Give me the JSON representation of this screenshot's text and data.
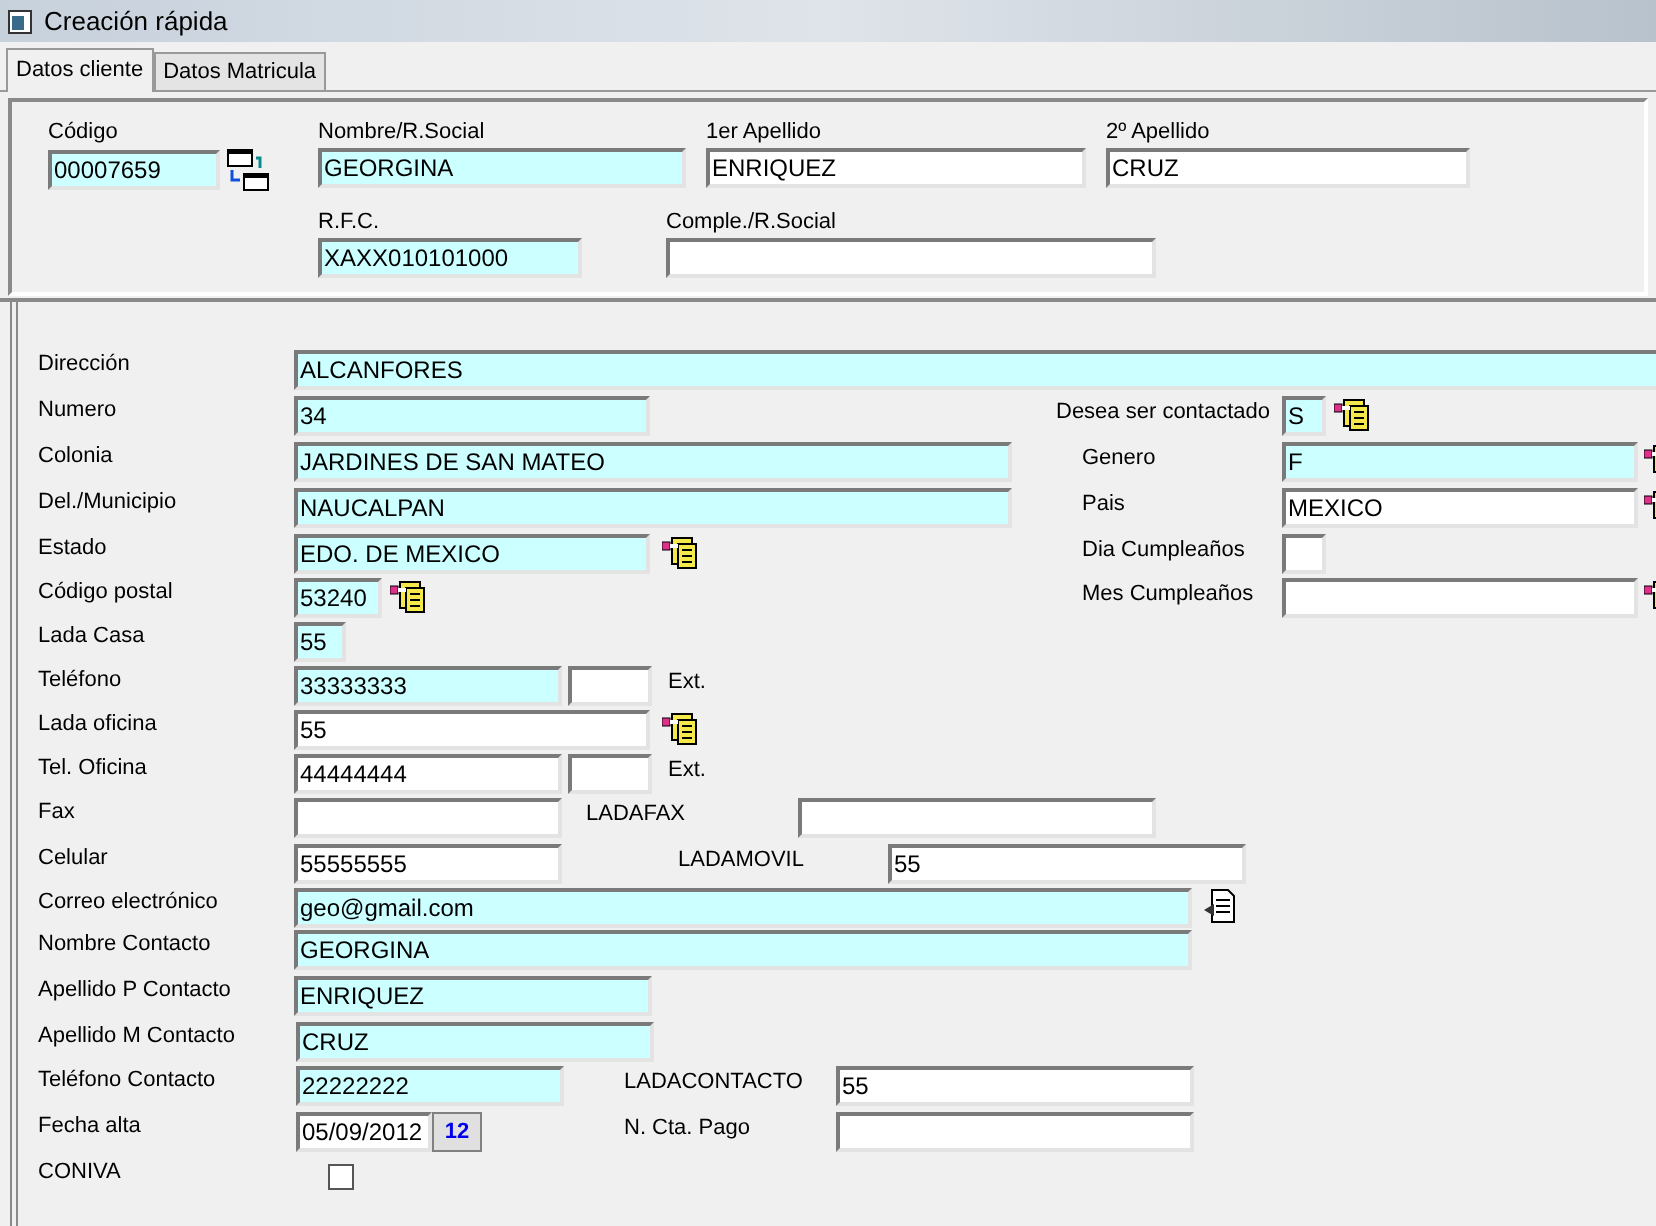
{
  "window": {
    "title": "Creación rápida"
  },
  "tabs": [
    {
      "label": "Datos cliente",
      "selected": true
    },
    {
      "label": "Datos Matricula",
      "selected": false
    }
  ],
  "top_fields": [
    [
      {
        "label": "Código",
        "value": "00007659",
        "highlighted": true
      },
      {
        "label": "Nombre/R.Social",
        "value": "GEORGINA",
        "highlighted": true
      },
      {
        "label": "1er Apellido",
        "value": "ENRIQUEZ",
        "highlighted": false
      },
      {
        "label": "2º Apellido",
        "value": "CRUZ",
        "highlighted": false
      }
    ],
    [
      {
        "label": "R.F.C.",
        "value": "XAXX010101000",
        "highlighted": true
      },
      {
        "label": "Comple./R.Social",
        "highlighted": false
      }
    ]
  ],
  "rows": [
    {
      "label": "Dirección",
      "items": [
        {
          "kind": "field",
          "value": "ALCANFORES",
          "highlighted": true
        }
      ]
    },
    {
      "label": "Numero",
      "items": [
        {
          "kind": "field",
          "value": "34",
          "highlighted": true
        },
        {
          "kind": "label",
          "text": "Desea ser contactado"
        },
        {
          "kind": "field",
          "value": "S",
          "highlighted": true
        },
        {
          "kind": "lookup"
        }
      ]
    },
    {
      "label": "Colonia",
      "items": [
        {
          "kind": "field",
          "value": "JARDINES DE SAN MATEO",
          "highlighted": true
        },
        {
          "kind": "label",
          "text": "Genero"
        },
        {
          "kind": "field",
          "value": "F",
          "highlighted": true
        },
        {
          "kind": "lookup"
        }
      ]
    },
    {
      "label": "Del./Municipio",
      "items": [
        {
          "kind": "field",
          "value": "NAUCALPAN",
          "highlighted": true
        },
        {
          "kind": "label",
          "text": "Pais"
        },
        {
          "kind": "field",
          "value": "MEXICO",
          "highlighted": false
        },
        {
          "kind": "lookup"
        }
      ]
    },
    {
      "label": "Estado",
      "items": [
        {
          "kind": "field",
          "value": "EDO. DE MEXICO",
          "highlighted": true
        },
        {
          "kind": "lookup"
        },
        {
          "kind": "label",
          "text": "Dia Cumpleaños"
        },
        {
          "kind": "field",
          "highlighted": false
        }
      ]
    },
    {
      "label": "Código postal",
      "items": [
        {
          "kind": "field",
          "value": "53240",
          "highlighted": true
        },
        {
          "kind": "lookup"
        },
        {
          "kind": "label",
          "text": "Mes Cumpleaños"
        },
        {
          "kind": "field",
          "highlighted": false
        },
        {
          "kind": "lookup"
        }
      ]
    },
    {
      "label": "Lada Casa",
      "items": [
        {
          "kind": "field",
          "value": "55",
          "highlighted": true
        }
      ]
    },
    {
      "label": "Teléfono",
      "items": [
        {
          "kind": "field",
          "value": "33333333",
          "highlighted": true
        },
        {
          "kind": "field",
          "highlighted": false
        },
        {
          "kind": "label",
          "text": "Ext."
        }
      ]
    },
    {
      "label": "Lada oficina",
      "items": [
        {
          "kind": "field",
          "value": "55",
          "highlighted": false
        },
        {
          "kind": "lookup"
        }
      ]
    },
    {
      "label": "Tel. Oficina",
      "items": [
        {
          "kind": "field",
          "value": "44444444",
          "highlighted": false
        },
        {
          "kind": "field",
          "highlighted": false
        },
        {
          "kind": "label",
          "text": "Ext."
        }
      ]
    },
    {
      "label": "Fax",
      "items": [
        {
          "kind": "field",
          "highlighted": false
        },
        {
          "kind": "label",
          "text": "LADAFAX"
        },
        {
          "kind": "field",
          "highlighted": false
        }
      ]
    },
    {
      "label": "Celular",
      "items": [
        {
          "kind": "field",
          "value": "55555555",
          "highlighted": false
        },
        {
          "kind": "label",
          "text": "LADAMOVIL"
        },
        {
          "kind": "field",
          "value": "55",
          "highlighted": false
        }
      ]
    },
    {
      "label": "Correo electrónico",
      "items": [
        {
          "kind": "field",
          "value": "geo@gmail.com",
          "highlighted": true
        },
        {
          "kind": "mail"
        }
      ]
    },
    {
      "label": "Nombre Contacto",
      "items": [
        {
          "kind": "field",
          "value": "GEORGINA",
          "highlighted": true
        }
      ]
    },
    {
      "label": "Apellido P Contacto",
      "items": [
        {
          "kind": "field",
          "value": "ENRIQUEZ",
          "highlighted": true
        }
      ]
    },
    {
      "label": "Apellido M Contacto",
      "items": [
        {
          "kind": "field",
          "value": "CRUZ",
          "highlighted": true
        }
      ]
    },
    {
      "label": "Teléfono Contacto",
      "items": [
        {
          "kind": "field",
          "value": "22222222",
          "highlighted": true
        },
        {
          "kind": "label",
          "text": "LADACONTACTO"
        },
        {
          "kind": "field",
          "value": "55",
          "highlighted": false
        }
      ]
    },
    {
      "label": "Fecha alta",
      "items": [
        {
          "kind": "date",
          "value": "05/09/2012",
          "button": "12"
        },
        {
          "kind": "label",
          "text": "N. Cta. Pago"
        },
        {
          "kind": "field",
          "highlighted": false
        }
      ]
    },
    {
      "label": "CONIVA",
      "items": [
        {
          "kind": "checkbox",
          "checked": false
        }
      ]
    }
  ]
}
